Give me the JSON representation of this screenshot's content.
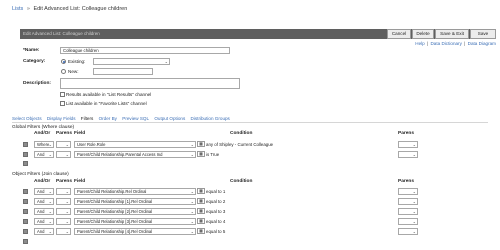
{
  "breadcrumb": {
    "root": "Lists",
    "separator": "»",
    "current": "Edit Advanced List: Colleague children"
  },
  "header": {
    "title": "Edit Advanced List: Colleague children"
  },
  "buttons": {
    "cancel": "Cancel",
    "delete": "Delete",
    "save_exit": "Save & Exit",
    "save": "Save"
  },
  "help_links": {
    "help": "Help",
    "data_dictionary": "Data Dictionary",
    "data_diagram": "Data Diagram",
    "separator": "|"
  },
  "form": {
    "name_label": "*Name:",
    "name_value": "Colleague children",
    "category_label": "Category:",
    "existing_label": "Existing:",
    "new_label": "New:",
    "description_label": "Description:",
    "results_label": "Results available in \"List Results\" channel",
    "favorite_label": "List available in \"Favorite Lists\" channel"
  },
  "tabs": [
    "Select Objects",
    "Display Fields",
    "Filters",
    "Order By",
    "Preview SQL",
    "Output Options",
    "Distribution Groups"
  ],
  "active_tab": "Filters",
  "global_filters": {
    "title": "Global Filters (Where clause)",
    "columns": {
      "andor": "And/Or",
      "parens": "Parens",
      "field": "Field",
      "condition": "Condition",
      "parens_right": "Parens"
    },
    "rows": [
      {
        "andor": "Where",
        "field": "User Role.Role",
        "condition": "any of Shipley - Current Colleague"
      },
      {
        "andor": "And",
        "field": "Parent/Child Relationship.Parental Access Ind",
        "condition": "is True"
      }
    ]
  },
  "object_filters": {
    "title": "Object Filters (Join clause)",
    "columns": {
      "andor": "And/Or",
      "parens": "Parens",
      "field": "Field",
      "condition": "Condition",
      "parens_right": "Parens"
    },
    "rows": [
      {
        "andor": "And",
        "field": "Parent/Child Relationship.Rel Ordinal",
        "condition": "equal to 1"
      },
      {
        "andor": "And",
        "field": "Parent/Child Relationship [1].Rel Ordinal",
        "condition": "equal to 2"
      },
      {
        "andor": "And",
        "field": "Parent/Child Relationship [2].Rel Ordinal",
        "condition": "equal to 3"
      },
      {
        "andor": "And",
        "field": "Parent/Child Relationship [3].Rel Ordinal",
        "condition": "equal to 4"
      },
      {
        "andor": "And",
        "field": "Parent/Child Relationship [4].Rel Ordinal",
        "condition": "equal to 5"
      }
    ]
  },
  "icons": {
    "remove_row": "gray-square-icon",
    "condition_edit": "condition-grid-icon",
    "dropdown": "chevron-down-icon"
  }
}
